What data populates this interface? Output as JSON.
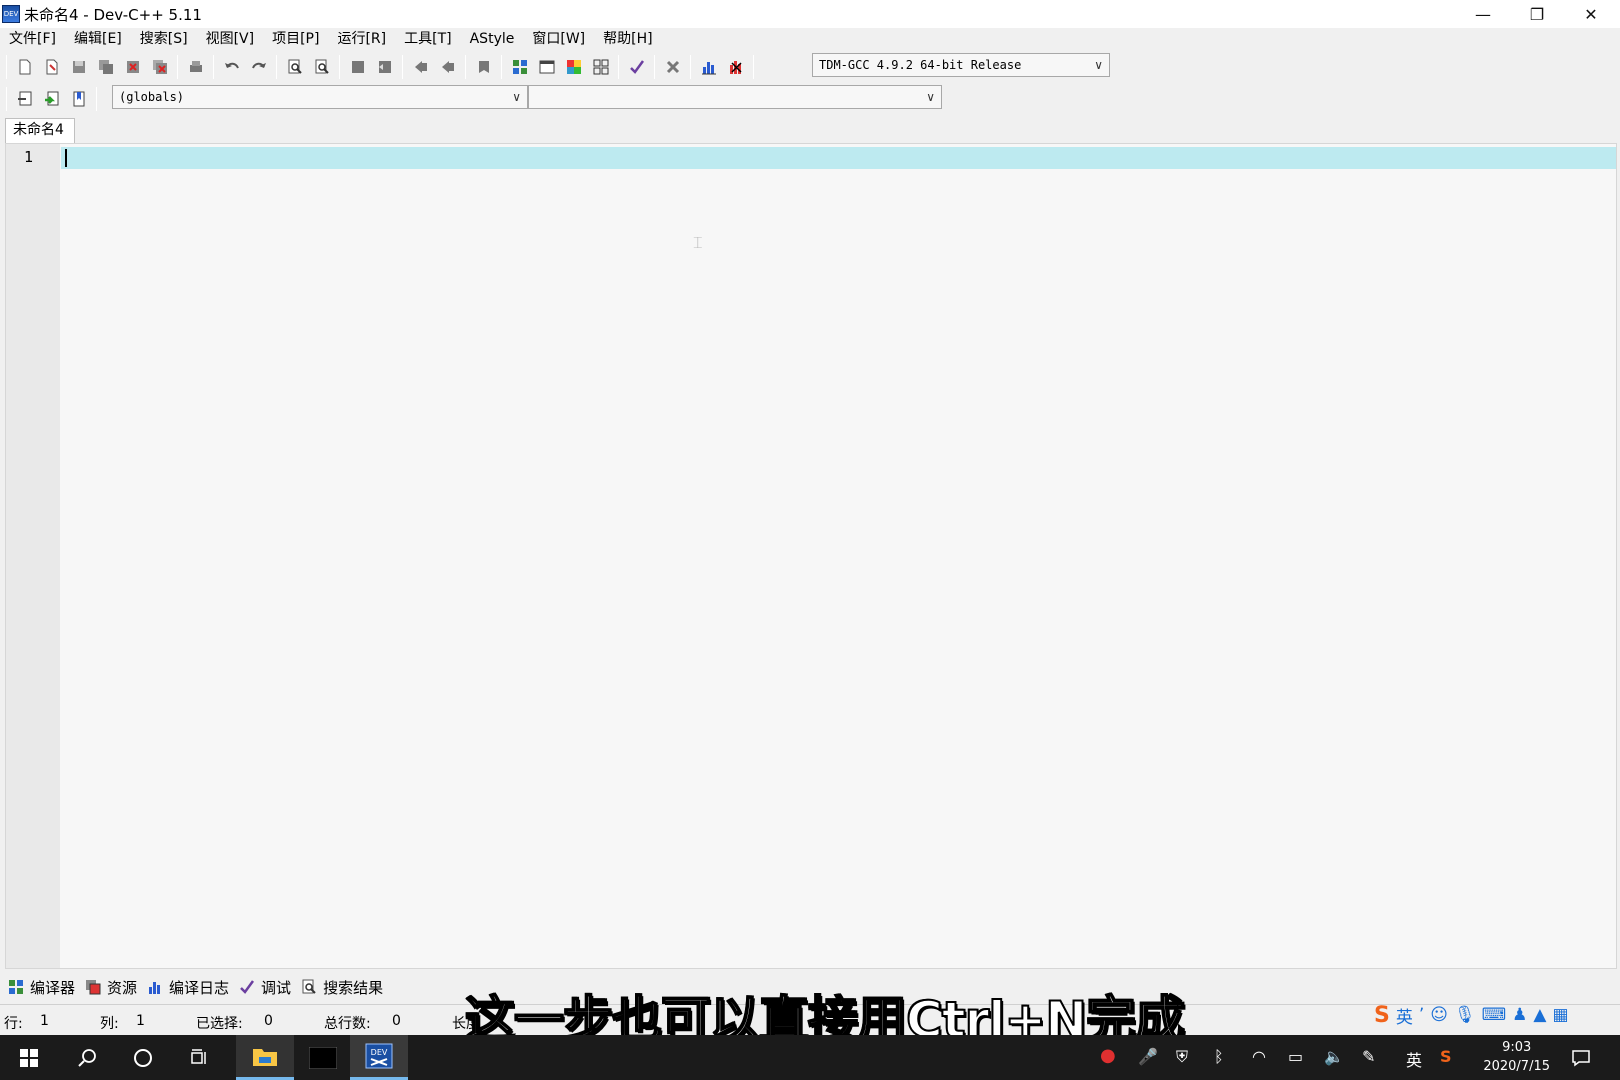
{
  "window": {
    "title": "未命名4 - Dev-C++ 5.11",
    "app_icon_text": "DEV"
  },
  "menu": [
    "文件[F]",
    "编辑[E]",
    "搜索[S]",
    "视图[V]",
    "项目[P]",
    "运行[R]",
    "工具[T]",
    "AStyle",
    "窗口[W]",
    "帮助[H]"
  ],
  "toolbar": {
    "compiler_select": "TDM-GCC 4.9.2 64-bit Release",
    "scope_select": "(globals)",
    "member_select": ""
  },
  "editor": {
    "tab_label": "未命名4",
    "line_number": "1"
  },
  "bottom_tabs": [
    "编译器",
    "资源",
    "编译日志",
    "调试",
    "搜索结果"
  ],
  "status": {
    "row_label": "行:",
    "row_value": "1",
    "col_label": "列:",
    "col_value": "1",
    "sel_label": "已选择:",
    "sel_value": "0",
    "lines_label": "总行数:",
    "lines_value": "0",
    "len_label": "长度"
  },
  "subtitle": "这一步也可以直接用Ctrl+N完成",
  "ime": {
    "lang": "英"
  },
  "tray": {
    "lang": "英"
  },
  "clock": {
    "time": "9:03",
    "date": "2020/7/15"
  },
  "colors": {
    "current_line": "#bdeaf0",
    "taskbar": "#1b1b1b",
    "brand_blue": "#1a4fa3"
  }
}
